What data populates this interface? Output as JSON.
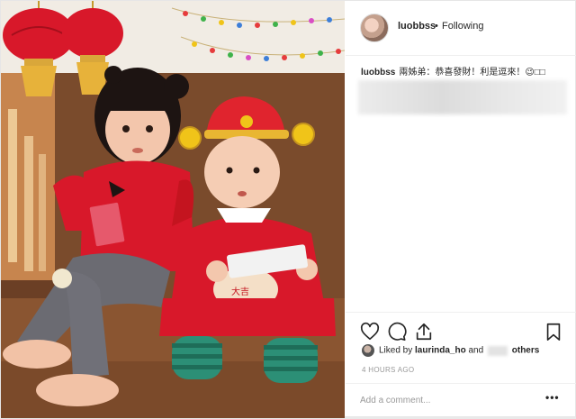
{
  "header": {
    "username": "luobbss",
    "separator": "•",
    "follow_state": "Following"
  },
  "caption": {
    "username": "luobbss",
    "text": "兩姊弟：恭喜發財！利是逗來！😉□□"
  },
  "actions": {
    "like_icon": "heart-icon",
    "comment_icon": "comment-bubble-icon",
    "share_icon": "share-icon",
    "save_icon": "bookmark-icon"
  },
  "likes": {
    "prefix": "Liked by",
    "user": "laurinda_ho",
    "conjunction": "and",
    "suffix": "others"
  },
  "timestamp": "4 HOURS AGO",
  "comment": {
    "placeholder": "Add a comment...",
    "more_label": "•••"
  },
  "colors": {
    "text": "#262626",
    "muted": "#999999",
    "divider": "#efefef",
    "photo_red": "#d8182a"
  }
}
